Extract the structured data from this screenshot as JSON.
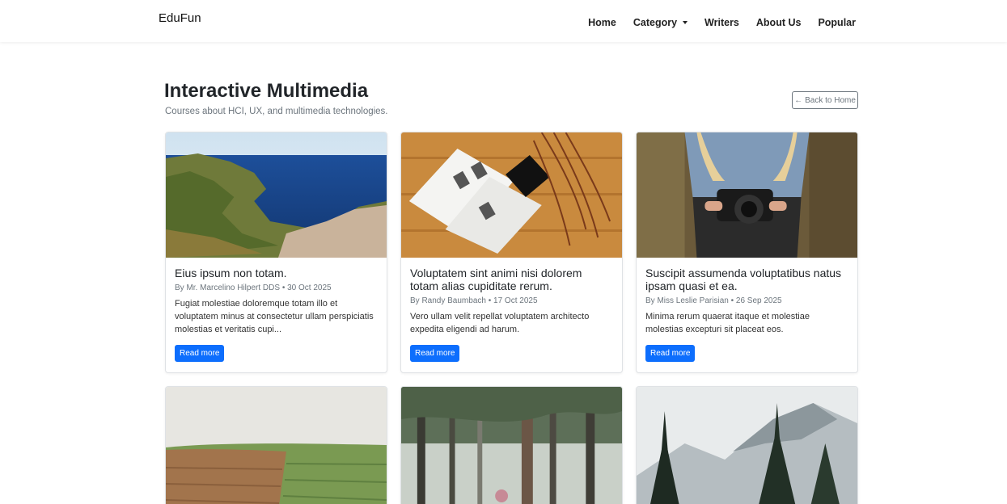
{
  "navbar": {
    "brand": "EduFun",
    "items": [
      {
        "label": "Home"
      },
      {
        "label": "Category"
      },
      {
        "label": "Writers"
      },
      {
        "label": "About Us"
      },
      {
        "label": "Popular"
      }
    ]
  },
  "header": {
    "title": "Interactive Multimedia",
    "subtitle": "Courses about HCI, UX, and multimedia technologies.",
    "back_arrow": "←",
    "back_label": "Back to Home"
  },
  "cards": [
    {
      "title": "Eius ipsum non totam.",
      "author": "By Mr. Marcelino Hilpert DDS",
      "separator": "•",
      "date": "30 Oct 2025",
      "excerpt": "Fugiat molestiae doloremque totam illo et voluptatem minus at consectetur ullam perspiciatis molestias et veritatis cupi...",
      "button": "Read more"
    },
    {
      "title": "Voluptatem sint animi nisi dolorem totam alias cupiditate rerum.",
      "author": "By Randy Baumbach",
      "separator": "•",
      "date": "17 Oct 2025",
      "excerpt": "Vero ullam velit repellat voluptatem architecto expedita eligendi ad harum.",
      "button": "Read more"
    },
    {
      "title": "Suscipit assumenda voluptatibus natus ipsam quasi et ea.",
      "author": "By Miss Leslie Parisian",
      "separator": "•",
      "date": "26 Sep 2025",
      "excerpt": "Minima rerum quaerat itaque et molestiae molestias excepturi sit placeat eos.",
      "button": "Read more"
    }
  ],
  "colors": {
    "primary": "#0d6efd",
    "muted": "#6c757d",
    "text": "#212529"
  }
}
